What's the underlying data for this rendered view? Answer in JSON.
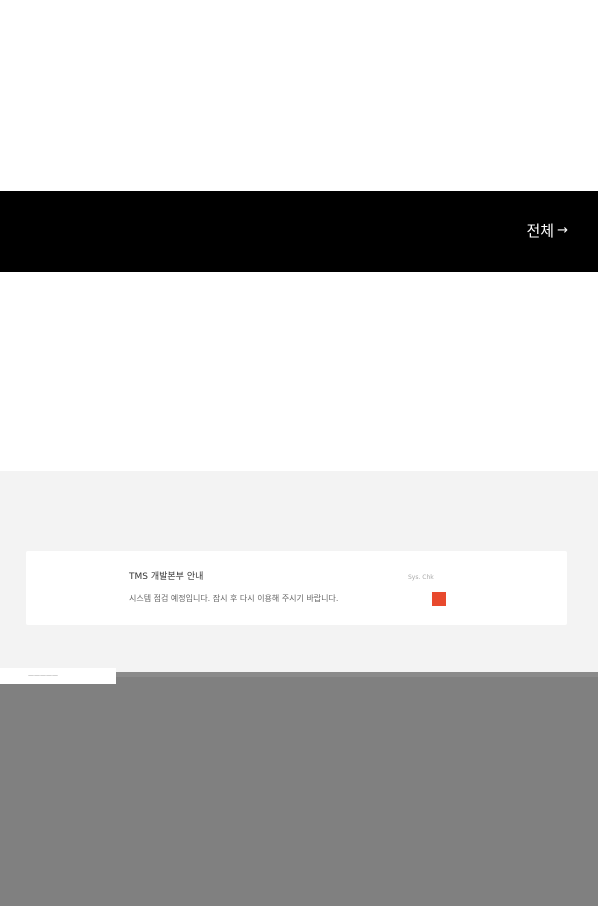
{
  "header_bar": {
    "link_label": "전체",
    "link_arrow": "→"
  },
  "notice": {
    "title": "TMS 개발본부 안내",
    "description": "시스템 점검 예정입니다. 잠시 후 다시 이용해 주시기 바랍니다.",
    "status_text": "Sys. Chk",
    "status_color": "#e8492d"
  },
  "overlay": {
    "tab_label": "—————"
  },
  "colors": {
    "black_bar": "#000000",
    "gray_section": "#f3f3f3",
    "overlay": "#808080"
  }
}
